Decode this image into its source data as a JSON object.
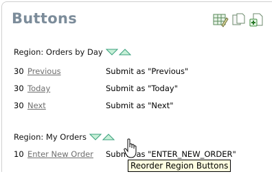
{
  "page": {
    "title": "Buttons",
    "toolbar_icons": [
      "grid-edit-icon",
      "copy-page-icon",
      "add-page-icon"
    ]
  },
  "regions": [
    {
      "heading": "Region: Orders by Day",
      "buttons": [
        {
          "seq": "30",
          "label": "Previous",
          "action": "Submit as \"Previous\""
        },
        {
          "seq": "30",
          "label": "Today",
          "action": "Submit as \"Today\""
        },
        {
          "seq": "30",
          "label": "Next",
          "action": "Submit as \"Next\""
        }
      ]
    },
    {
      "heading": "Region: My Orders",
      "buttons": [
        {
          "seq": "10",
          "label": "Enter New Order",
          "action": "Submit as \"ENTER_NEW_ORDER\""
        }
      ]
    }
  ],
  "tooltip": "Reorder Region Buttons",
  "colors": {
    "title": "#7c8c9a",
    "arrow_fill": "#c8f0d8",
    "arrow_stroke": "#3aa07c",
    "tooltip_bg": "#ffffe1"
  }
}
